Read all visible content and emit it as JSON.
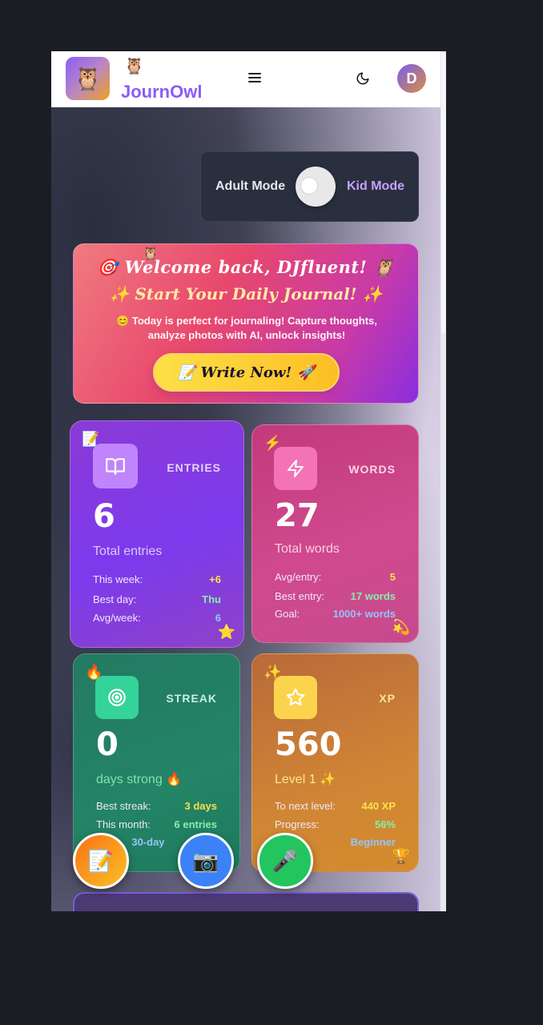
{
  "header": {
    "logo_emoji": "🦉",
    "logo_small_emoji": "🦉",
    "app_title": "JournOwl",
    "menu_icon": "menu-icon",
    "theme_icon": "moon-icon",
    "avatar_initial": "D"
  },
  "mode_toggle": {
    "adult_label": "Adult Mode",
    "kid_label": "Kid Mode",
    "selected": "Adult Mode"
  },
  "welcome": {
    "owl_emoji": "🦉",
    "title": "🎯 Welcome back, DJfluent! 🦉",
    "subtitle": "✨ Start Your Daily Journal! ✨",
    "description": "😊 Today is perfect for journaling! Capture thoughts, analyze photos with AI, unlock insights!",
    "button_label": "📝 Write Now! 🚀"
  },
  "stats": {
    "entries": {
      "corner_emoji": "📝",
      "label": "ENTRIES",
      "value": "6",
      "caption": "Total entries",
      "rows": [
        {
          "key": "This week:",
          "value": "+6"
        },
        {
          "key": "Best day:",
          "value": "Thu"
        },
        {
          "key": "Avg/week:",
          "value": "6"
        }
      ],
      "bottom_emoji": "⭐"
    },
    "words": {
      "corner_emoji": "⚡",
      "label": "WORDS",
      "value": "27",
      "caption": "Total words",
      "rows": [
        {
          "key": "Avg/entry:",
          "value": "5"
        },
        {
          "key": "Best entry:",
          "value": "17 words"
        },
        {
          "key": "Goal:",
          "value": "1000+ words"
        }
      ],
      "bottom_emoji": "💫"
    },
    "streak": {
      "corner_emoji": "🔥",
      "label": "STREAK",
      "value": "0",
      "caption": "days strong 🔥",
      "rows": [
        {
          "key": "Best streak:",
          "value": "3 days"
        },
        {
          "key": "This month:",
          "value": "6 entries"
        },
        {
          "key": "Next:",
          "value": "30-day"
        }
      ]
    },
    "xp": {
      "corner_emoji": "✨",
      "label": "XP",
      "value": "560",
      "caption": "Level 1 ✨",
      "rows": [
        {
          "key": "To next level:",
          "value": "440 XP"
        },
        {
          "key": "Progress:",
          "value": "56%"
        },
        {
          "key": "",
          "value": "Beginner"
        }
      ],
      "bottom_emoji": "🏆"
    }
  },
  "fabs": {
    "write": "📝",
    "camera": "📷",
    "mic": "🎤"
  },
  "colors": {
    "brand": "#8b5cf6",
    "yellow_value": "#fde047",
    "green_value": "#86efac",
    "blue_value": "#93c5fd"
  }
}
